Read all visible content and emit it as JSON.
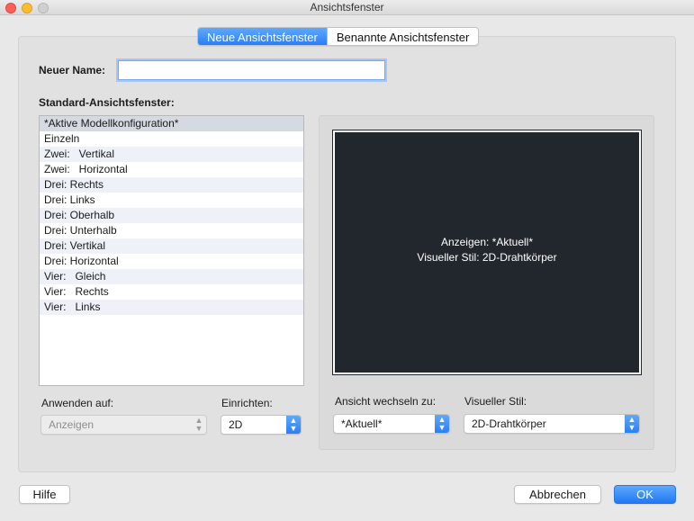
{
  "window": {
    "title": "Ansichtsfenster"
  },
  "tabs": [
    {
      "label": "Neue Ansichtsfenster",
      "active": true
    },
    {
      "label": "Benannte Ansichtsfenster",
      "active": false
    }
  ],
  "form": {
    "new_name_label": "Neuer Name:",
    "new_name_value": "",
    "standard_label": "Standard-Ansichtsfenster:",
    "apply_label": "Anwenden auf:",
    "apply_value": "Anzeigen",
    "setup_label": "Einrichten:",
    "setup_value": "2D",
    "change_view_label": "Ansicht wechseln zu:",
    "change_view_value": "*Aktuell*",
    "visual_style_label": "Visueller Stil:",
    "visual_style_value": "2D-Drahtkörper"
  },
  "viewports": [
    "*Aktive Modellkonfiguration*",
    "Einzeln",
    "Zwei:   Vertikal",
    "Zwei:   Horizontal",
    "Drei: Rechts",
    "Drei: Links",
    "Drei: Oberhalb",
    "Drei: Unterhalb",
    "Drei: Vertikal",
    "Drei: Horizontal",
    "Vier:   Gleich",
    "Vier:   Rechts",
    "Vier:   Links"
  ],
  "preview": {
    "line1": "Anzeigen: *Aktuell*",
    "line2": "Visueller Stil: 2D-Drahtkörper"
  },
  "buttons": {
    "help": "Hilfe",
    "cancel": "Abbrechen",
    "ok": "OK"
  },
  "colors": {
    "accent": "#2a7ff6",
    "preview_bg": "#22272d"
  }
}
